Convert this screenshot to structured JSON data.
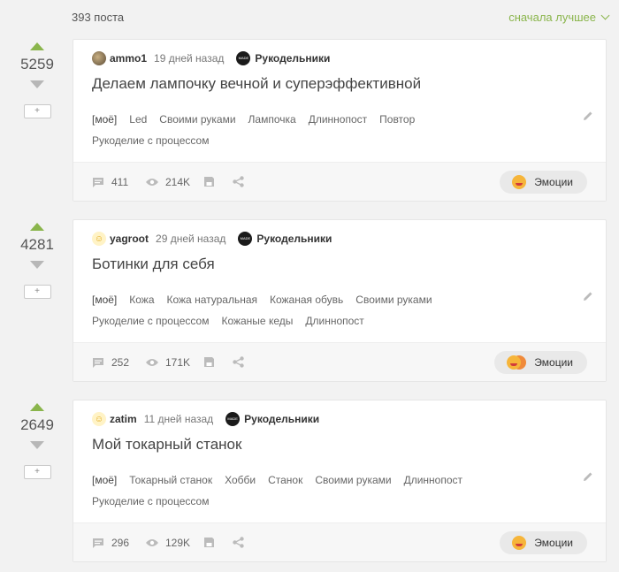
{
  "header": {
    "count": "393 поста",
    "sort": "сначала лучшее"
  },
  "posts": [
    {
      "rating": "5259",
      "author": "ammo1",
      "time": "19 дней назад",
      "community": "Рукодельники",
      "community_logo": "MADE WITH HANDS",
      "title": "Делаем лампочку вечной и суперэффективной",
      "tags": [
        "[моё]",
        "Led",
        "Своими руками",
        "Лампочка",
        "Длиннопост",
        "Повтор",
        "Рукоделие с процессом"
      ],
      "comments": "411",
      "views": "214K",
      "emotions_label": "Эмоции"
    },
    {
      "rating": "4281",
      "author": "yagroot",
      "time": "29 дней назад",
      "community": "Рукодельники",
      "community_logo": "MADE WITH HANDS",
      "title": "Ботинки для себя",
      "tags": [
        "[моё]",
        "Кожа",
        "Кожа натуральная",
        "Кожаная обувь",
        "Своими руками",
        "Рукоделие с процессом",
        "Кожаные кеды",
        "Длиннопост"
      ],
      "comments": "252",
      "views": "171K",
      "emotions_label": "Эмоции"
    },
    {
      "rating": "2649",
      "author": "zatim",
      "time": "11 дней назад",
      "community": "Рукодельники",
      "community_logo": "MADE WITH HANDS",
      "title": "Мой токарный станок",
      "tags": [
        "[моё]",
        "Токарный станок",
        "Хобби",
        "Станок",
        "Своими руками",
        "Длиннопост",
        "Рукоделие с процессом"
      ],
      "comments": "296",
      "views": "129K",
      "emotions_label": "Эмоции"
    }
  ],
  "icons": {
    "vote_up": "arrow-up-icon",
    "vote_down": "arrow-down-icon",
    "comments": "comment-icon",
    "views": "eye-icon",
    "save": "save-icon",
    "share": "share-icon",
    "edit": "pencil-icon"
  },
  "colors": {
    "accent": "#8ab54c",
    "background": "#f2f2f2",
    "card": "#ffffff"
  }
}
